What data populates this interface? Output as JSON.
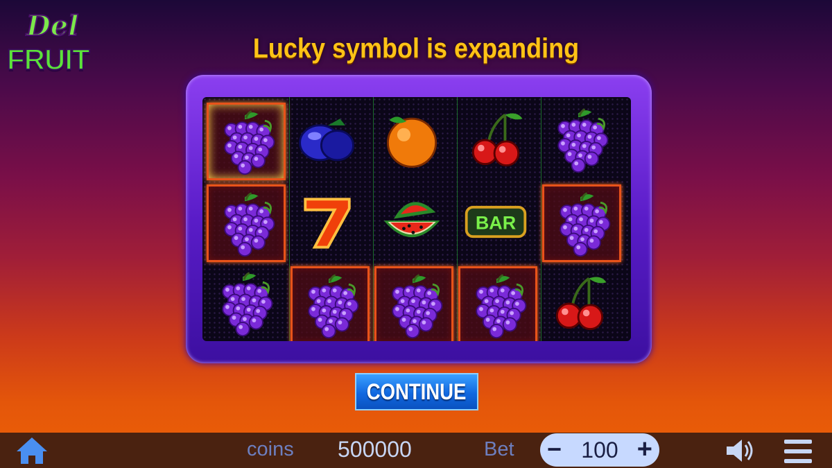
{
  "logo": {
    "line1": "Del",
    "line2": "FRUIT"
  },
  "title": "Lucky symbol is expanding",
  "reels": [
    [
      {
        "symbol": "grapes",
        "win": true,
        "glow": true
      },
      {
        "symbol": "grapes",
        "win": true
      },
      {
        "symbol": "grapes",
        "win": false
      }
    ],
    [
      {
        "symbol": "plum",
        "win": false
      },
      {
        "symbol": "seven",
        "win": false
      },
      {
        "symbol": "grapes",
        "win": true
      }
    ],
    [
      {
        "symbol": "orange",
        "win": false
      },
      {
        "symbol": "watermelon",
        "win": false
      },
      {
        "symbol": "grapes",
        "win": true
      }
    ],
    [
      {
        "symbol": "cherries",
        "win": false
      },
      {
        "symbol": "bar",
        "win": false
      },
      {
        "symbol": "grapes",
        "win": true
      }
    ],
    [
      {
        "symbol": "grapes",
        "win": false
      },
      {
        "symbol": "grapes",
        "win": true
      },
      {
        "symbol": "cherries",
        "win": false
      }
    ]
  ],
  "bar_symbol_text": "BAR",
  "continue_label": "CONTINUE",
  "footer": {
    "coins_label": "coins",
    "coins_value": "500000",
    "bet_label": "Bet",
    "bet_value": "100",
    "minus": "−",
    "plus": "+"
  },
  "icons": {
    "home": "home-icon",
    "sound": "speaker-icon",
    "menu": "hamburger-menu-icon"
  },
  "colors": {
    "title": "#ffc316",
    "win_border": "#e8531a",
    "button": "#1168e0",
    "footer_bg": "#4a2210"
  }
}
